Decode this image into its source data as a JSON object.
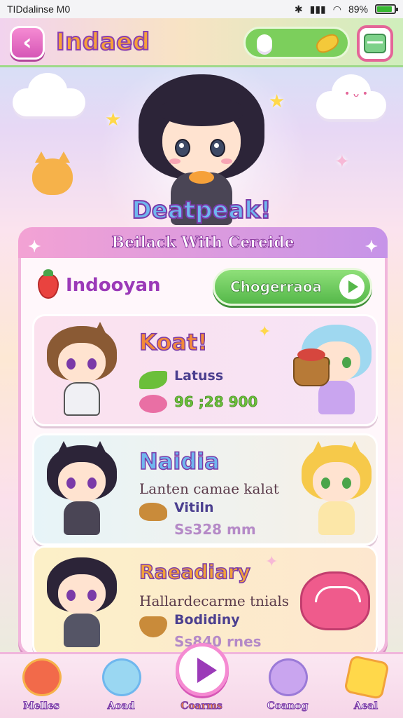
{
  "status_bar": {
    "left_text": "TIDdalinse M0",
    "battery_text": "89%",
    "battery_level": 0.89
  },
  "header": {
    "back_icon": "chevron-left-icon",
    "title": "Indaed",
    "currency_icons": [
      "cloud-icon",
      "coin-icon"
    ],
    "menu_icon": "menu-icon"
  },
  "hero": {
    "caption": "Deatpeak!"
  },
  "panel": {
    "header_title": "Beilack With Cereide",
    "sub_title": "Indooyan",
    "action_button_label": "Chogerraoa",
    "cards": [
      {
        "title": "Koat!",
        "line1": "Latuss",
        "line2": "96 ;28 900",
        "accent_color": "#f28a3a"
      },
      {
        "title": "Naidia",
        "subtitle": "Lanten camae kalat",
        "line1": "Vitiln",
        "line2": "Ss328 mm",
        "accent_color": "#6fb7ee"
      },
      {
        "title": "Raeadiary",
        "subtitle": "Hallardecarme tnials",
        "line1": "Bodidiny",
        "line2": "Ss840 rnes",
        "accent_color": "#f2a23a"
      }
    ]
  },
  "bottom_nav": {
    "items": [
      {
        "label": "Melles",
        "icon": "fruit-creature-icon"
      },
      {
        "label": "Aoad",
        "icon": "blob-creature-icon"
      },
      {
        "label": "Coarms",
        "icon": "play-icon"
      },
      {
        "label": "Coanog",
        "icon": "ghost-creature-icon"
      },
      {
        "label": "Aeal",
        "icon": "star-icon"
      }
    ]
  },
  "colors": {
    "accent_pink": "#f58bd2",
    "accent_green": "#55b84a",
    "title_outline": "#7a3aa8"
  }
}
